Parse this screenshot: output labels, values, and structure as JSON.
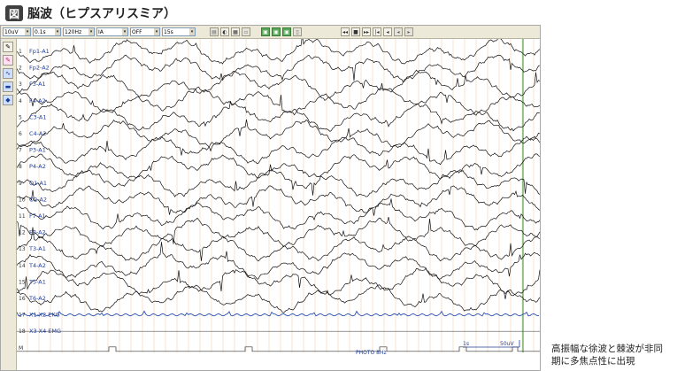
{
  "figure": {
    "badge": "図",
    "title": "脳波（ヒプスアリスミア）"
  },
  "toolbar": {
    "selects": [
      "10uV",
      "0.1s",
      "120Hz",
      "IA",
      "OFF",
      "15s"
    ],
    "tool_icons": [
      "print-icon",
      "zoom-icon",
      "measure-icon",
      "copy-icon"
    ],
    "green_buttons": [
      "montage-a-icon",
      "montage-b-icon",
      "montage-c-icon",
      "page-icon"
    ],
    "playback": [
      "rewind-icon",
      "stop-icon",
      "fast-forward-icon",
      "skip-start-icon",
      "step-back-icon",
      "step-forward-icon",
      "skip-end-icon"
    ]
  },
  "side_toolbar": [
    "pen-icon",
    "marker-icon",
    "wave-icon",
    "panel-icon",
    "eraser-icon"
  ],
  "channels": [
    {
      "num": "1",
      "label": "Fp1-A1"
    },
    {
      "num": "2",
      "label": "Fp2-A2"
    },
    {
      "num": "3",
      "label": "F3-A1"
    },
    {
      "num": "4",
      "label": "F4-A2"
    },
    {
      "num": "5",
      "label": "C3-A1"
    },
    {
      "num": "6",
      "label": "C4-A2"
    },
    {
      "num": "7",
      "label": "P3-A1"
    },
    {
      "num": "8",
      "label": "P4-A2"
    },
    {
      "num": "9",
      "label": "O1-A1"
    },
    {
      "num": "10",
      "label": "O2-A2"
    },
    {
      "num": "11",
      "label": "F7-A1"
    },
    {
      "num": "12",
      "label": "F8-A2"
    },
    {
      "num": "13",
      "label": "T3-A1"
    },
    {
      "num": "14",
      "label": "T4-A2"
    },
    {
      "num": "15",
      "label": "T5-A1"
    },
    {
      "num": "16",
      "label": "T6-A2"
    },
    {
      "num": "17",
      "label": "X1-X2 EKG"
    },
    {
      "num": "18",
      "label": "X3-X4 EMG"
    },
    {
      "num": "M",
      "label": ""
    }
  ],
  "annotations": {
    "photo": "PHOTO 8Hz",
    "scale_time": "1s",
    "scale_amp": "50uV"
  },
  "colors": {
    "trace": "#111111",
    "ekg": "#2a4fb0",
    "gridline": "#f3c79a",
    "green_marker": "#2a9a3a",
    "label": "#1f3d9a"
  },
  "caption": {
    "line1": "高振幅な徐波と棘波が非同",
    "line2": "期に多焦点性に出現"
  }
}
